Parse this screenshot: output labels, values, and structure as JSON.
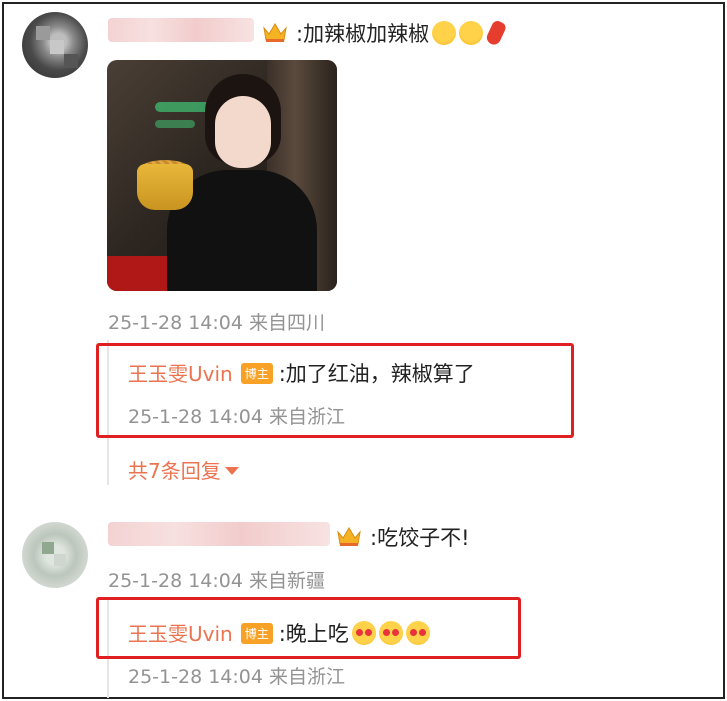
{
  "comments": [
    {
      "text": ":加辣椒加辣椒",
      "emojis": [
        "hug-emoji",
        "hug-emoji",
        "chili-pepper-emoji"
      ],
      "time": "25-1-28 14:04 来自四川",
      "replies": [
        {
          "author": "王玉雯Uvin",
          "badge": "博主",
          "text": ":加了红油，辣椒算了",
          "time": "25-1-28 14:04 来自浙江"
        }
      ],
      "more_replies": "共7条回复"
    },
    {
      "text": ":吃饺子不!",
      "time": "25-1-28 14:04 来自新疆",
      "replies": [
        {
          "author": "王玉雯Uvin",
          "badge": "博主",
          "text": ":晚上吃",
          "emojis": [
            "heart-eyes-emoji",
            "heart-eyes-emoji",
            "heart-eyes-emoji"
          ],
          "time": "25-1-28 14:04 来自浙江"
        }
      ]
    }
  ],
  "colors": {
    "author": "#eb7350",
    "badge": "#f7a226",
    "highlight_border": "#e02020",
    "meta": "#939393"
  }
}
